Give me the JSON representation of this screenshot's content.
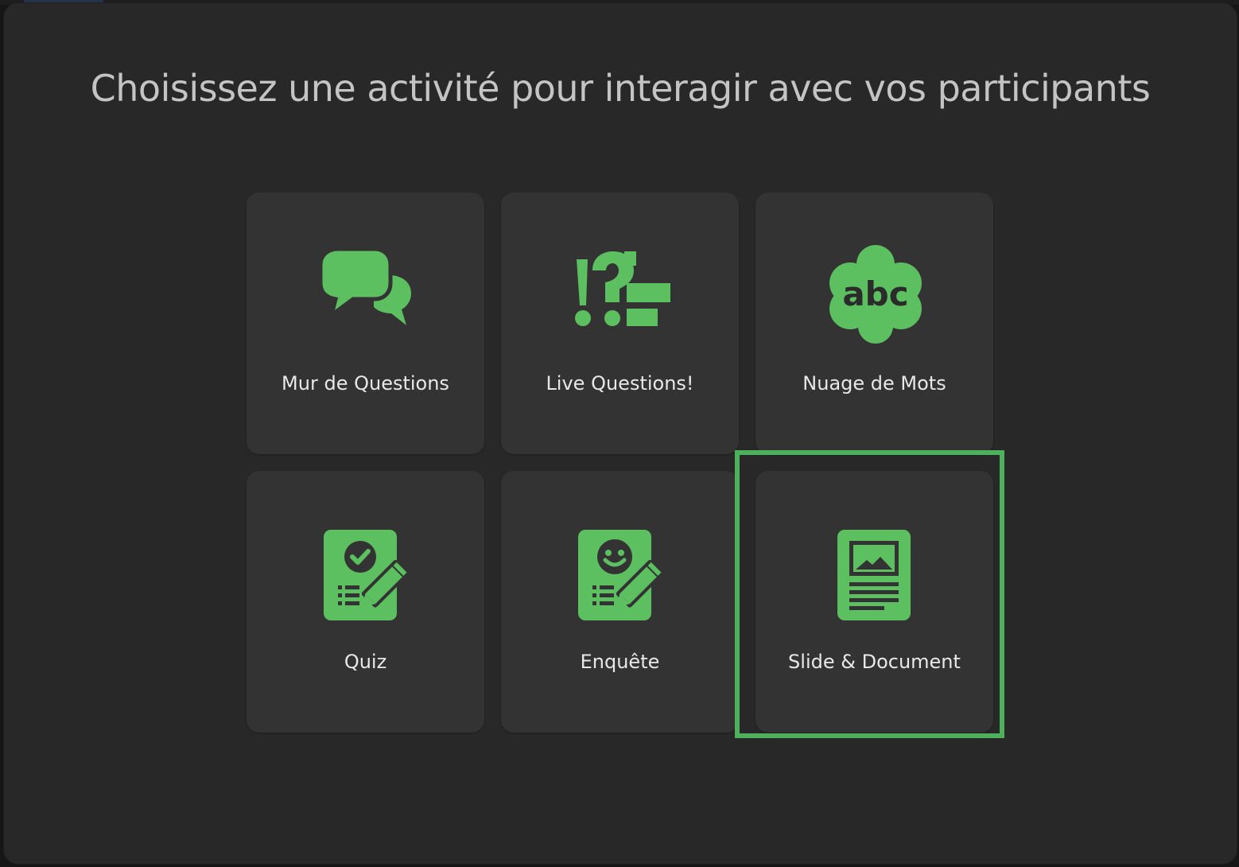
{
  "dialog": {
    "title": "Choisissez une activité pour interagir avec vos participants"
  },
  "accent_color": "#5cbf60",
  "activities": [
    {
      "label": "Mur de Questions",
      "icon": "chat-bubbles-icon"
    },
    {
      "label": "Live Questions!",
      "icon": "live-questions-icon"
    },
    {
      "label": "Nuage de Mots",
      "icon": "word-cloud-icon"
    },
    {
      "label": "Quiz",
      "icon": "quiz-checklist-icon"
    },
    {
      "label": "Enquête",
      "icon": "survey-smiley-icon"
    },
    {
      "label": "Slide & Document",
      "icon": "slide-document-icon",
      "highlighted": true
    }
  ]
}
